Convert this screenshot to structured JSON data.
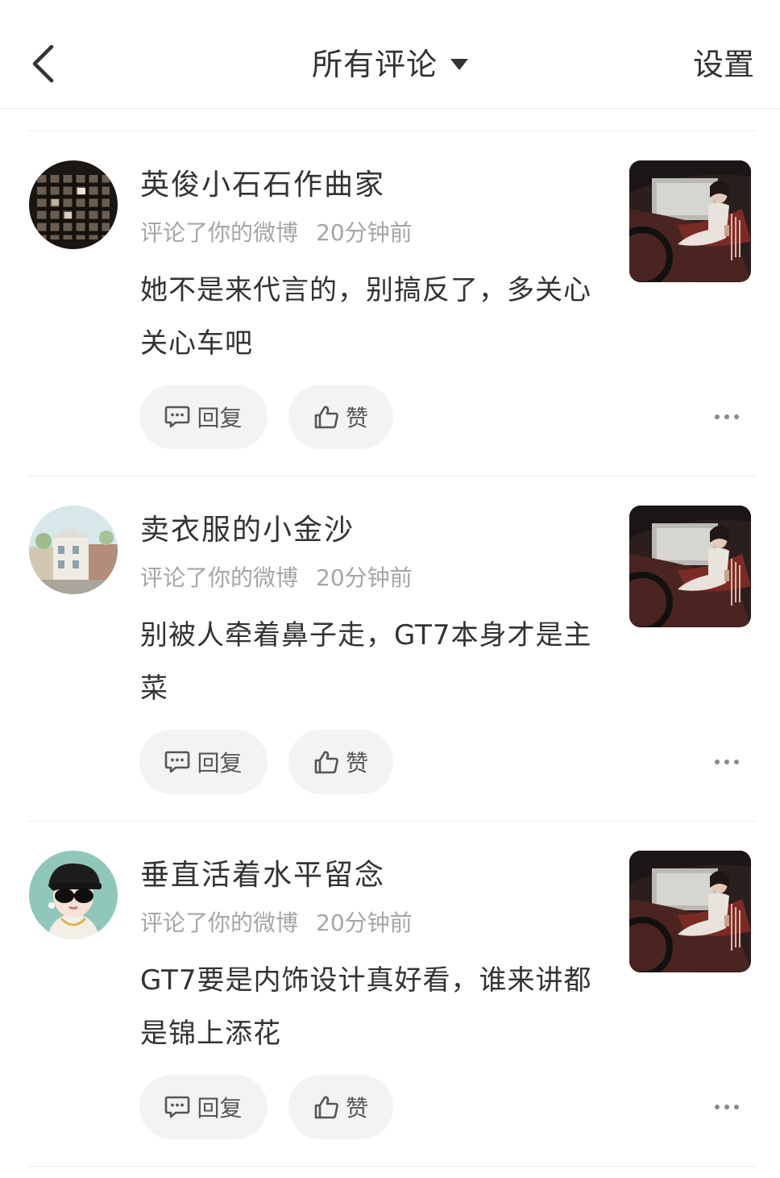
{
  "header": {
    "title": "所有评论",
    "settings_label": "设置"
  },
  "comments": [
    {
      "username": "英俊小石石作曲家",
      "action": "评论了你的微博",
      "time": "20分钟前",
      "text": "她不是来代言的，别搞反了，多关心关心车吧",
      "reply_label": "回复",
      "like_label": "赞"
    },
    {
      "username": "卖衣服的小金沙",
      "action": "评论了你的微博",
      "time": "20分钟前",
      "text": "别被人牵着鼻子走，GT7本身才是主菜",
      "reply_label": "回复",
      "like_label": "赞"
    },
    {
      "username": "垂直活着水平留念",
      "action": "评论了你的微博",
      "time": "20分钟前",
      "text": "GT7要是内饰设计真好看，谁来讲都是锦上添花",
      "reply_label": "回复",
      "like_label": "赞"
    }
  ],
  "colors": {
    "text_primary": "#333333",
    "text_secondary": "#a6a6a6",
    "button_bg": "#f3f3f3",
    "divider": "#ececec"
  },
  "icons": {
    "back": "chevron-left-icon",
    "dropdown": "caret-down-icon",
    "reply": "comment-bubble-icon",
    "like": "thumbs-up-icon",
    "more": "more-dots-icon"
  }
}
